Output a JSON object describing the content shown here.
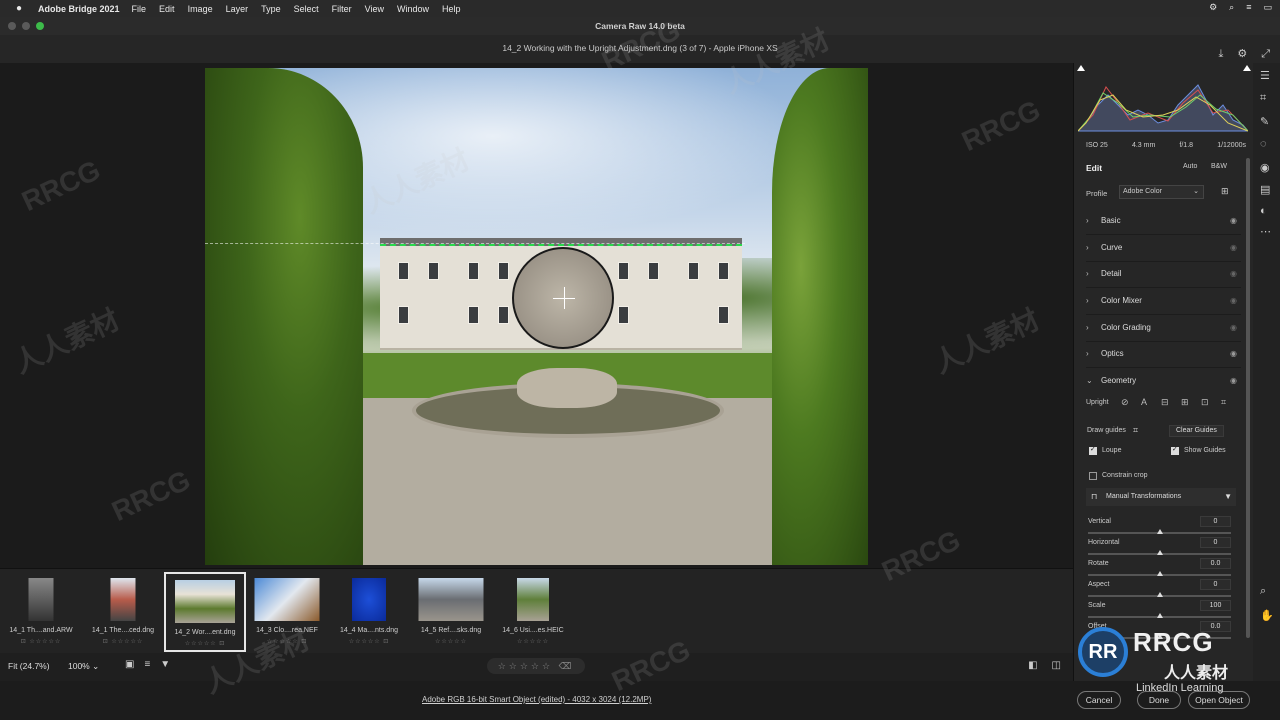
{
  "menubar": {
    "app_name": "Adobe Bridge 2021",
    "menus": [
      "File",
      "Edit",
      "Image",
      "Layer",
      "Type",
      "Select",
      "Filter",
      "View",
      "Window",
      "Help"
    ]
  },
  "window": {
    "title": "Camera Raw 14.0 beta",
    "file_header": "14_2 Working with the Upright Adjustment.dng (3 of 7)  -  Apple iPhone XS"
  },
  "histogram": {
    "iso": "ISO 25",
    "focal": "4.3 mm",
    "aperture": "f/1.8",
    "shutter": "1/12000s"
  },
  "edit_panel": {
    "title": "Edit",
    "auto": "Auto",
    "bw": "B&W",
    "profile_label": "Profile",
    "profile_value": "Adobe Color",
    "sections": [
      "Basic",
      "Curve",
      "Detail",
      "Color Mixer",
      "Color Grading",
      "Optics",
      "Geometry"
    ],
    "upright_label": "Upright",
    "draw_guides": "Draw guides",
    "clear_guides": "Clear Guides",
    "loupe": "Loupe",
    "show_guides": "Show Guides",
    "constrain_crop": "Constrain crop",
    "manual_transformations": "Manual Transformations",
    "sliders": [
      {
        "label": "Vertical",
        "value": "0",
        "level": 0.5
      },
      {
        "label": "Horizontal",
        "value": "0",
        "level": 0.5
      },
      {
        "label": "Rotate",
        "value": "0.0",
        "level": 0.5
      },
      {
        "label": "Aspect",
        "value": "0",
        "level": 0.5
      },
      {
        "label": "Scale",
        "value": "100",
        "level": 0.5
      },
      {
        "label": "Offset",
        "value": "0.0",
        "level": 0.5
      }
    ]
  },
  "filmstrip": [
    {
      "name": "14_1 Th....and.ARW"
    },
    {
      "name": "14_1 The....ced.dng"
    },
    {
      "name": "14_2 Wor....ent.dng"
    },
    {
      "name": "14_3 Clo....rea.NEF"
    },
    {
      "name": "14_4 Ma....nts.dng"
    },
    {
      "name": "14_5 Ref....sks.dng"
    },
    {
      "name": "14_6 Usi....es.HEIC"
    }
  ],
  "bottombar": {
    "zoom_fit": "Fit (24.7%)",
    "zoom_pct": "100%",
    "stars": "☆☆☆☆☆"
  },
  "status": {
    "info": "Adobe RGB 16-bit Smart Object (edited) - 4032 x 3024 (12.2MP)",
    "cancel": "Cancel",
    "done": "Done",
    "open": "Open Object"
  },
  "watermarks": {
    "rrcg": "RRCG",
    "cn": "人人素材"
  },
  "logo": {
    "badge": "RR",
    "big": "RRCG",
    "cn": "人人素材",
    "overlay": "LinkedIn Learning"
  }
}
